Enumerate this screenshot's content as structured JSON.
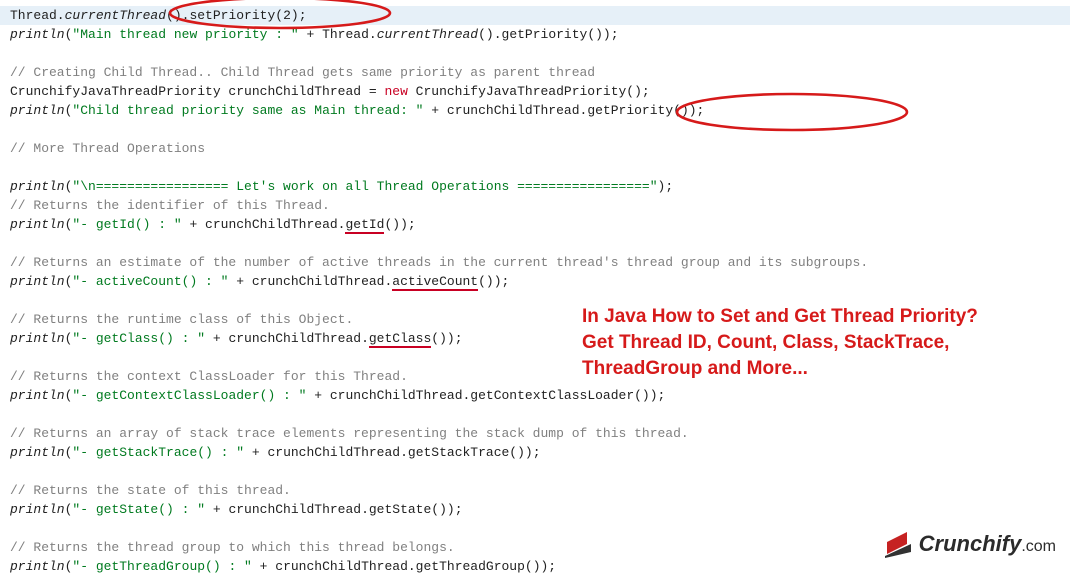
{
  "overlay": {
    "line1": "In Java How to Set and Get Thread Priority?",
    "line2": "Get Thread ID, Count, Class, StackTrace,",
    "line3": "ThreadGroup and More..."
  },
  "logo": {
    "name": "Crunchify",
    "suffix": ".com"
  },
  "code": {
    "l1": {
      "a": "Thread.",
      "b": "currentThread",
      "c": "().",
      "d": "setPriority",
      "e": "(",
      "f": "2",
      "g": ");"
    },
    "l2": {
      "a": "println",
      "b": "(",
      "s": "\"Main thread new priority : \"",
      "c": " + Thread.",
      "d": "currentThread",
      "e": "().getPriority());"
    },
    "l4c": "// Creating Child Thread.. Child Thread gets same priority as parent thread",
    "l5": {
      "a": "CrunchifyJavaThreadPriority crunchChildThread = ",
      "kw": "new",
      "b": " CrunchifyJavaThreadPriority();"
    },
    "l6": {
      "a": "println",
      "b": "(",
      "s": "\"Child thread priority same as Main thread: \"",
      "c": " + crunchChildThread.",
      "m": "getPriority",
      "d": "());"
    },
    "l8c": "// More Thread Operations",
    "l10": {
      "a": "println",
      "b": "(",
      "s": "\"\\n================= Let's work on all Thread Operations =================\"",
      "c": ");"
    },
    "l11c": "// Returns the identifier of this Thread.",
    "l12": {
      "a": "println",
      "b": "(",
      "s": "\"- getId() : \"",
      "c": " + crunchChildThread.",
      "m": "getId",
      "d": "());"
    },
    "l14c": "// Returns an estimate of the number of active threads in the current thread's thread group and its subgroups.",
    "l15": {
      "a": "println",
      "b": "(",
      "s": "\"- activeCount() : \"",
      "c": " + crunchChildThread.",
      "m": "activeCount",
      "d": "());"
    },
    "l17c": "// Returns the runtime class of this Object.",
    "l18": {
      "a": "println",
      "b": "(",
      "s": "\"- getClass() : \"",
      "c": " + crunchChildThread.",
      "m": "getClass",
      "d": "());"
    },
    "l20c": "// Returns the context ClassLoader for this Thread.",
    "l21": {
      "a": "println",
      "b": "(",
      "s": "\"- getContextClassLoader() : \"",
      "c": " + crunchChildThread.getContextClassLoader());"
    },
    "l23c": "// Returns an array of stack trace elements representing the stack dump of this thread.",
    "l24": {
      "a": "println",
      "b": "(",
      "s": "\"- getStackTrace() : \"",
      "c": " + crunchChildThread.getStackTrace());"
    },
    "l26c": "// Returns the state of this thread.",
    "l27": {
      "a": "println",
      "b": "(",
      "s": "\"- getState() : \"",
      "c": " + crunchChildThread.getState());"
    },
    "l29c": "// Returns the thread group to which this thread belongs.",
    "l30": {
      "a": "println",
      "b": "(",
      "s": "\"- getThreadGroup() : \"",
      "c": " + crunchChildThread.getThreadGroup());"
    }
  }
}
